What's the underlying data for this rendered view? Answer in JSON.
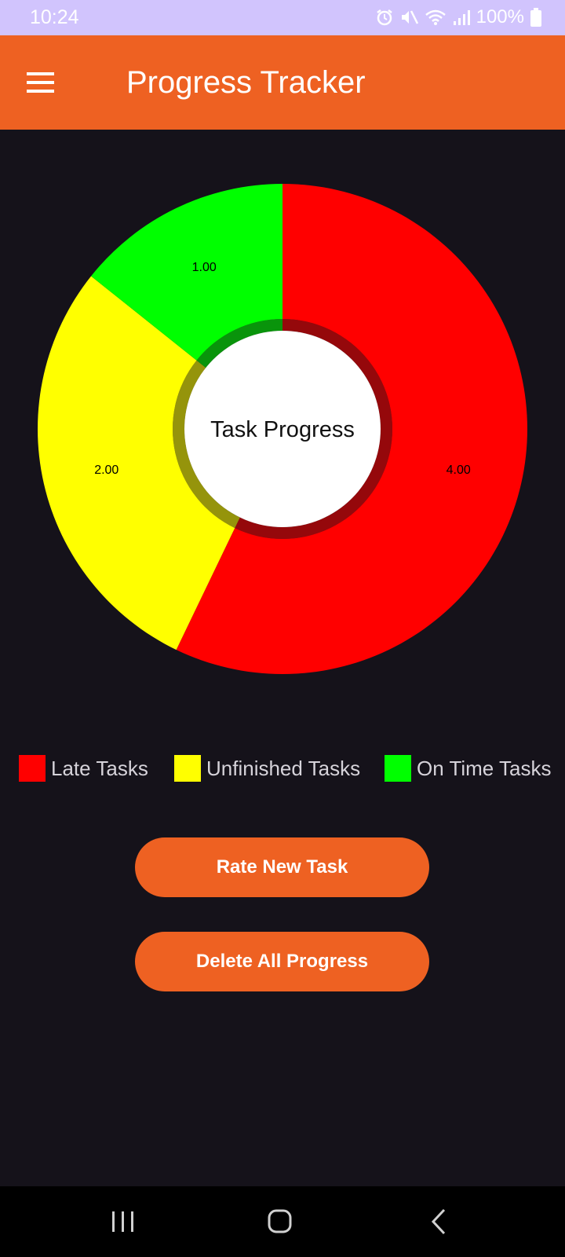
{
  "status_bar": {
    "time": "10:24",
    "battery": "100%",
    "icons": [
      "alarm-icon",
      "mute-icon",
      "wifi-icon",
      "signal-icon",
      "battery-icon"
    ]
  },
  "app_bar": {
    "title": "Progress Tracker",
    "menu_icon": "hamburger-menu-icon",
    "color": "#ee6122"
  },
  "chart_data": {
    "type": "pie",
    "center_text": "Task Progress",
    "slices": [
      {
        "label": "Late Tasks",
        "value": 4.0,
        "value_label": "4.00",
        "color": "#ff0000"
      },
      {
        "label": "Unfinished Tasks",
        "value": 2.0,
        "value_label": "2.00",
        "color": "#ffff00"
      },
      {
        "label": "On Time Tasks",
        "value": 1.0,
        "value_label": "1.00",
        "color": "#00ff00"
      }
    ],
    "legend_position": "bottom"
  },
  "legend": {
    "items": [
      {
        "label": "Late Tasks",
        "color": "#ff0000"
      },
      {
        "label": "Unfinished Tasks",
        "color": "#ffff00"
      },
      {
        "label": "On Time Tasks",
        "color": "#00ff00"
      }
    ]
  },
  "buttons": {
    "rate_new_task": "Rate New Task",
    "delete_all_progress": "Delete All Progress"
  },
  "nav_bar": {
    "icons": [
      "recent-apps-icon",
      "home-icon",
      "back-icon"
    ]
  }
}
